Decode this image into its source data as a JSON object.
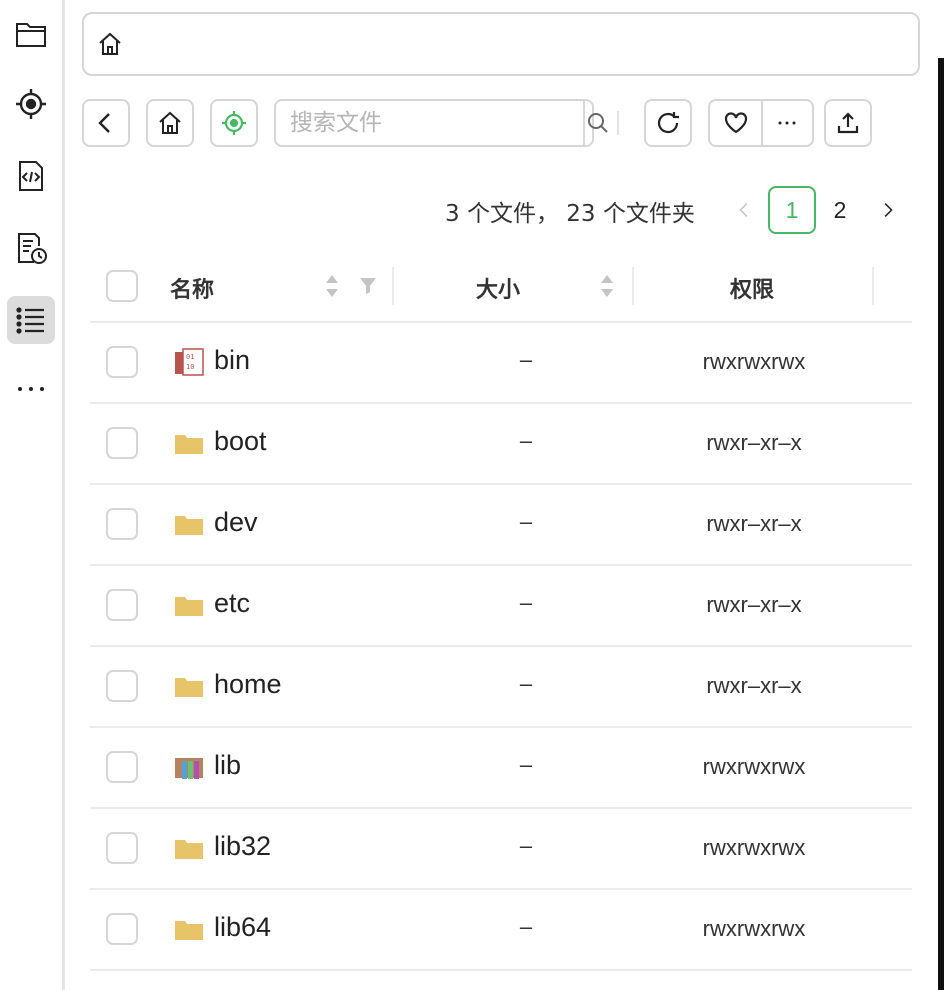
{
  "sidebar": {
    "items": [
      {
        "name": "files",
        "icon": "folder-icon"
      },
      {
        "name": "locate",
        "icon": "crosshair-icon"
      },
      {
        "name": "code",
        "icon": "code-file-icon"
      },
      {
        "name": "history",
        "icon": "file-clock-icon"
      },
      {
        "name": "list",
        "icon": "list-icon",
        "active": true
      },
      {
        "name": "more",
        "icon": "ellipsis-icon"
      }
    ]
  },
  "address_bar": {
    "icon": "home-icon",
    "path": ""
  },
  "toolbar": {
    "search_placeholder": "搜索文件",
    "icons": [
      "back-icon",
      "home-icon",
      "locate-icon",
      "search-icon",
      "refresh-icon",
      "heart-icon",
      "ellipsis-icon",
      "upload-icon"
    ]
  },
  "summary": {
    "text": "3 个文件， 23 个文件夹"
  },
  "pagination": {
    "current": "1",
    "next": "2"
  },
  "table": {
    "columns": {
      "name": "名称",
      "size": "大小",
      "permission": "权限"
    },
    "rows": [
      {
        "name": "bin",
        "size": "–",
        "permission": "rwxrwxrwx",
        "type": "binary-link"
      },
      {
        "name": "boot",
        "size": "–",
        "permission": "rwxr–xr–x",
        "type": "folder"
      },
      {
        "name": "dev",
        "size": "–",
        "permission": "rwxr–xr–x",
        "type": "folder"
      },
      {
        "name": "etc",
        "size": "–",
        "permission": "rwxr–xr–x",
        "type": "folder"
      },
      {
        "name": "home",
        "size": "–",
        "permission": "rwxr–xr–x",
        "type": "folder"
      },
      {
        "name": "lib",
        "size": "–",
        "permission": "rwxrwxrwx",
        "type": "library-link"
      },
      {
        "name": "lib32",
        "size": "–",
        "permission": "rwxrwxrwx",
        "type": "folder"
      },
      {
        "name": "lib64",
        "size": "–",
        "permission": "rwxrwxrwx",
        "type": "folder"
      }
    ]
  },
  "colors": {
    "accent": "#47b864",
    "folder": "#e8c469",
    "border": "#d6d6d6"
  }
}
